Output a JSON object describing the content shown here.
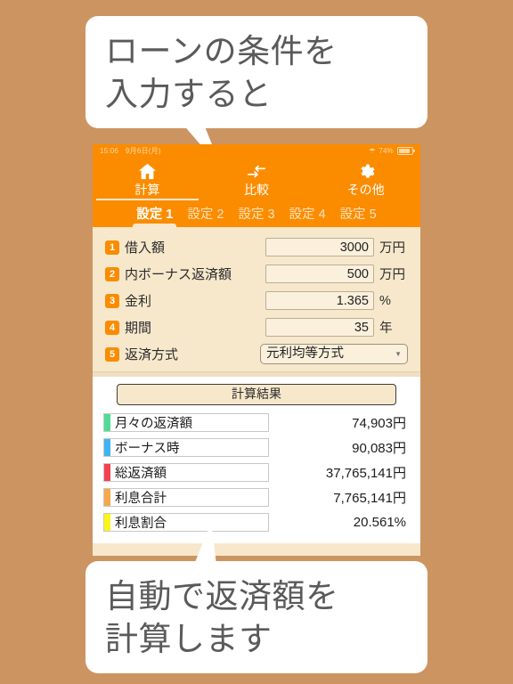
{
  "theme": {
    "background": "#cc9461",
    "accent": "#fb8c00",
    "panel": "#f7e8cc",
    "callout_text": "#5a5a5a"
  },
  "callouts": {
    "top": {
      "line1": "ローンの条件を",
      "line2": "入力すると"
    },
    "bottom": {
      "line1": "自動で返済額を",
      "line2": "計算します"
    }
  },
  "statusbar": {
    "time": "15:06",
    "date": "9月6日(月)",
    "wifi_icon": "wifi-icon",
    "battery_percent": "74%",
    "battery_icon": "battery-icon"
  },
  "main_tabs": [
    {
      "label": "計算",
      "icon": "home-icon",
      "active": true
    },
    {
      "label": "比較",
      "icon": "compare-arrows-icon",
      "active": false
    },
    {
      "label": "その他",
      "icon": "gear-icon",
      "active": false
    }
  ],
  "sub_tabs": [
    {
      "label": "設定 1",
      "active": true
    },
    {
      "label": "設定 2",
      "active": false
    },
    {
      "label": "設定 3",
      "active": false
    },
    {
      "label": "設定 4",
      "active": false
    },
    {
      "label": "設定 5",
      "active": false
    }
  ],
  "inputs": [
    {
      "no": "1",
      "label": "借入額",
      "value": "3000",
      "unit": "万円",
      "type": "text"
    },
    {
      "no": "2",
      "label": "内ボーナス返済額",
      "value": "500",
      "unit": "万円",
      "type": "text"
    },
    {
      "no": "3",
      "label": "金利",
      "value": "1.365",
      "unit": "%",
      "type": "text"
    },
    {
      "no": "4",
      "label": "期間",
      "value": "35",
      "unit": "年",
      "type": "text"
    },
    {
      "no": "5",
      "label": "返済方式",
      "value": "元利均等方式",
      "unit": "",
      "type": "select"
    }
  ],
  "results": {
    "button_label": "計算結果",
    "rows": [
      {
        "label": "月々の返済額",
        "value": "74,903円",
        "color": "#4fdd95"
      },
      {
        "label": "ボーナス時",
        "value": "90,083円",
        "color": "#40b4f2"
      },
      {
        "label": "総返済額",
        "value": "37,765,141円",
        "color": "#f4414f"
      },
      {
        "label": "利息合計",
        "value": "7,765,141円",
        "color": "#f6a94a"
      },
      {
        "label": "利息割合",
        "value": "20.561%",
        "color": "#fbf51a"
      }
    ]
  }
}
